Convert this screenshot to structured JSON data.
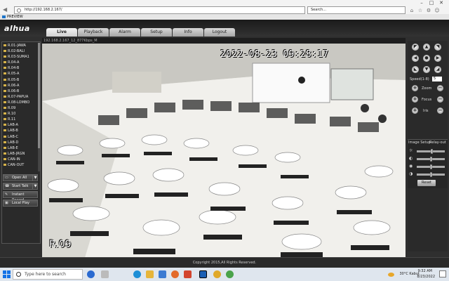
{
  "browser": {
    "url": "http://192.168.2.167/",
    "search_placeholder": "Search...",
    "tab_title": "PREVIEW",
    "win_min": "–",
    "win_max": "□",
    "win_close": "✕"
  },
  "app": {
    "logo": "alhua",
    "nav": [
      "Live",
      "Playback",
      "Alarm",
      "Setup",
      "Info",
      "Logout"
    ],
    "active_tab": "Live"
  },
  "channels": [
    {
      "label": "R.01-JAWA",
      "mark": ""
    },
    {
      "label": "R.02-BALI",
      "mark": "M"
    },
    {
      "label": "R.03-SUMA1",
      "mark": ""
    },
    {
      "label": "R.04-A",
      "mark": ""
    },
    {
      "label": "R.04-B",
      "mark": ""
    },
    {
      "label": "R.05-A",
      "mark": ""
    },
    {
      "label": "R.05-B",
      "mark": ""
    },
    {
      "label": "R.06-A",
      "mark": ""
    },
    {
      "label": "R.06-B",
      "mark": ""
    },
    {
      "label": "R.07-PAPUA",
      "mark": ""
    },
    {
      "label": "R.08-LOMBO",
      "mark": ""
    },
    {
      "label": "R.09",
      "mark": "M"
    },
    {
      "label": "R.10",
      "mark": ""
    },
    {
      "label": "R.11",
      "mark": ""
    },
    {
      "label": "LAB-A",
      "mark": ""
    },
    {
      "label": "LAB-B",
      "mark": ""
    },
    {
      "label": "LAB-C",
      "mark": ""
    },
    {
      "label": "LAB-D",
      "mark": ""
    },
    {
      "label": "LAB-E",
      "mark": ""
    },
    {
      "label": "LAB-JRGN",
      "mark": ""
    },
    {
      "label": "CAN-IN",
      "mark": ""
    },
    {
      "label": "CAN-OUT",
      "mark": ""
    }
  ],
  "left_buttons": {
    "open_all": "Open All",
    "start_talk": "Start Talk",
    "instant_record": "Instant Record",
    "local_play": "Local Play"
  },
  "video": {
    "header": "192.168.2.167_12_877Kbps_M",
    "timestamp": "2022-08-23 09:28:17",
    "camera_name": "R.09"
  },
  "ptz": {
    "speed_label": "Speed(1-8)",
    "speed_value": "5",
    "zoom": "Zoom",
    "focus": "Focus",
    "iris": "Iris"
  },
  "image_setup": {
    "tab1": "Image Setup",
    "tab2": "Relay-out",
    "reset": "Reset",
    "levels": [
      0.55,
      0.5,
      0.5,
      0.5
    ]
  },
  "footer": "Copyright 2015,All Rights Reserved.",
  "taskbar": {
    "search_placeholder": "Type here to search",
    "weather": "30°C  Kabut",
    "time": "9:32 AM",
    "date": "8/23/2022"
  }
}
